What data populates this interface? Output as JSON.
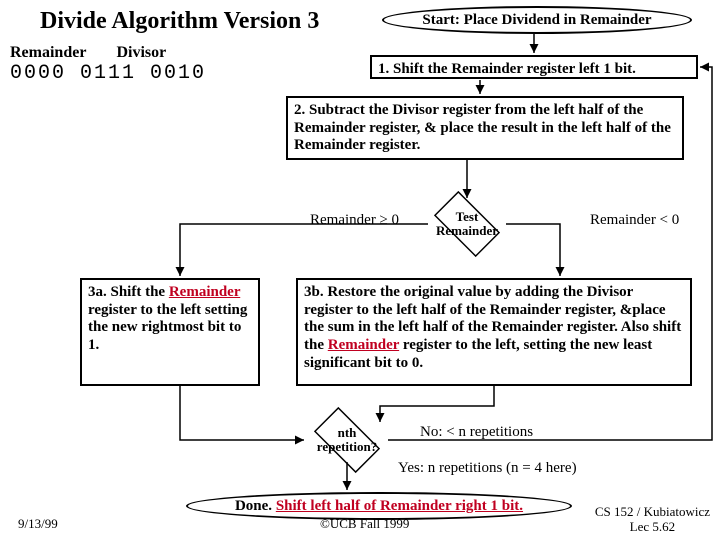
{
  "title": "Divide Algorithm Version 3",
  "registers": {
    "remainder_label": "Remainder",
    "divisor_label": "Divisor",
    "remainder_value": "0000 0111",
    "divisor_value": "0010"
  },
  "steps": {
    "start": "Start: Place Dividend in Remainder",
    "s1": "1. Shift the Remainder register left 1 bit.",
    "s2": "2. Subtract the Divisor register from the left half of the Remainder register, & place the result in the left half of the Remainder register.",
    "test_label": "Test Remainder",
    "branch_ge": "Remainder ≥ 0",
    "branch_lt": "Remainder < 0",
    "s3a_pre": "3a. Shift the ",
    "s3a_word": "Remainder",
    "s3a_post": " register to the left setting the new rightmost  bit to 1.",
    "s3b_pre": "3b. Restore the original value by adding the Divisor register to the left half of the Remainder register, &place the sum in the left half of the Remainder register. Also shift the ",
    "s3b_word": "Remainder",
    "s3b_post": " register to the left, setting the new least significant bit to 0.",
    "nth_label": "nth repetition?",
    "branch_no": "No: < n repetitions",
    "branch_yes": "Yes: n repetitions (n = 4 here)",
    "done_pre": "Done. ",
    "done_red": "Shift left half of Remainder right 1 bit."
  },
  "footer": {
    "date": "9/13/99",
    "mid": "©UCB Fall 1999",
    "right1": "CS 152 / Kubiatowicz",
    "right2": "Lec 5.62"
  }
}
